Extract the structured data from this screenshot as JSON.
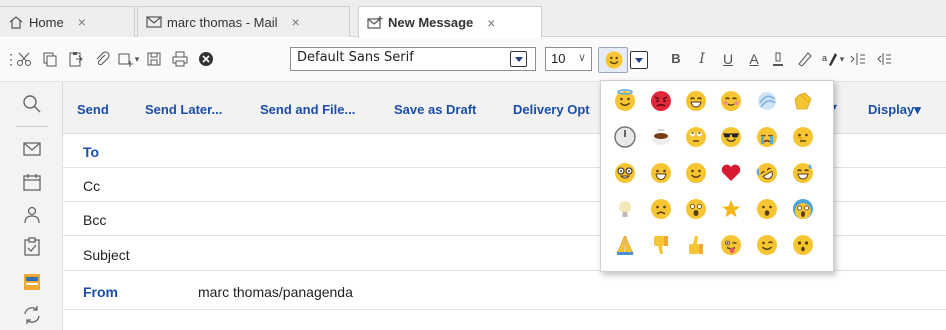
{
  "tabs": [
    {
      "label": "Home",
      "icon": "home-icon",
      "active": false
    },
    {
      "label": "marc thomas - Mail",
      "icon": "mail-icon",
      "active": false
    },
    {
      "label": "New Message",
      "icon": "new-mail-icon",
      "active": true
    }
  ],
  "tab_close_glyph": "×",
  "toolbar": {
    "font_name": "Default Sans Serif",
    "font_size": "10",
    "format_letters": {
      "bold": "B",
      "italic": "I",
      "underline": "U",
      "font_color": "A"
    }
  },
  "actions": [
    {
      "label": "Send"
    },
    {
      "label": "Send Later..."
    },
    {
      "label": "Send and File..."
    },
    {
      "label": "Save as Draft"
    },
    {
      "label": "Delivery Opt"
    }
  ],
  "display_button": "Display▾",
  "action_tail": "▾",
  "form": {
    "to_label": "To",
    "cc_label": "Cc",
    "bcc_label": "Bcc",
    "subject_label": "Subject",
    "from_label": "From",
    "from_value": "marc thomas/panagenda"
  },
  "emoji_grid": [
    [
      "angel-emoji",
      "angry-emoji",
      "grin-emoji",
      "blush-emoji",
      "dizzy-emoji",
      "clap-emoji"
    ],
    [
      "clock-emoji",
      "coffee-emoji",
      "eyeroll-emoji",
      "sunglasses-emoji",
      "crying-emoji",
      "thinking-emoji"
    ],
    [
      "nerd-emoji",
      "grinning-emoji",
      "smile-emoji",
      "heart-emoji",
      "rofl-emoji",
      "sweat-smile-emoji"
    ],
    [
      "bulb-emoji",
      "sad-emoji",
      "shocked-emoji",
      "star-emoji",
      "surprised-emoji",
      "scream-emoji"
    ],
    [
      "pray-emoji",
      "thumbs-down-emoji",
      "thumbs-up-emoji",
      "tongue-wink-emoji",
      "wink-emoji",
      "astonished-emoji"
    ]
  ],
  "colors": {
    "accent_blue": "#1a4ea8",
    "emoji_yellow": "#f6c532",
    "heart_red": "#d81b30"
  }
}
